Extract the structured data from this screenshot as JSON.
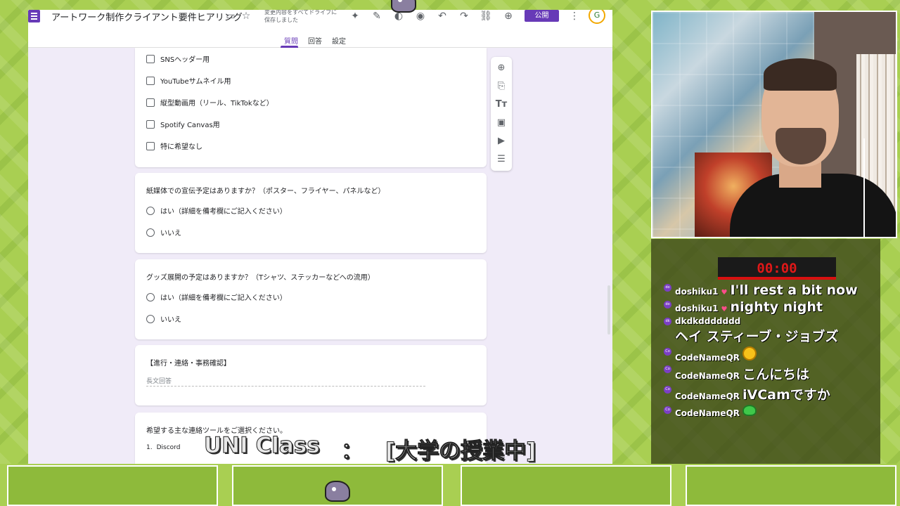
{
  "forms": {
    "title": "アートワーク制作クライアント要件ヒアリング",
    "save_status": "変更内容をすべてドライブに保存しました",
    "publish_label": "公開",
    "avatar_text": "G",
    "tabs": [
      {
        "label": "質問"
      },
      {
        "label": "回答"
      },
      {
        "label": "設定"
      }
    ],
    "checkbox_options": [
      {
        "label": "SNSヘッダー用"
      },
      {
        "label": "YouTubeサムネイル用"
      },
      {
        "label": "縦型動画用（リール、TikTokなど）"
      },
      {
        "label": "Spotify Canvas用"
      },
      {
        "label": "特に希望なし"
      }
    ],
    "q_print": {
      "title": "紙媒体での宣伝予定はありますか？（ポスター、フライヤー、パネルなど）",
      "options": [
        "はい（詳細を備考欄にご記入ください）",
        "いいえ"
      ]
    },
    "q_goods": {
      "title": "グッズ展開の予定はありますか？（Tシャツ、ステッカーなどへの流用）",
      "options": [
        "はい（詳細を備考欄にご記入ください）",
        "いいえ"
      ]
    },
    "section": {
      "title": "【進行・連絡・事務確認】",
      "placeholder": "長文回答"
    },
    "q_tools": {
      "title": "希望する主な連絡ツールをご選択ください。",
      "first_item_number": "1.",
      "first_item": "Discord"
    }
  },
  "timer": "00:00",
  "chat": [
    {
      "badge": "do",
      "user": "doshiku1",
      "heart": true,
      "text": "I'll rest a bit now"
    },
    {
      "badge": "do",
      "user": "doshiku1",
      "heart": true,
      "text": "nighty night"
    },
    {
      "badge": "dk",
      "user": "dkdkddddddd",
      "heart": false,
      "text": "ヘイ スティーブ・ジョブズ"
    },
    {
      "badge": "Co",
      "user": "CodeNameQR",
      "heart": false,
      "text": "",
      "emoji": "grinning-face"
    },
    {
      "badge": "Co",
      "user": "CodeNameQR",
      "heart": false,
      "text": "こんにちは"
    },
    {
      "badge": "Co",
      "user": "CodeNameQR",
      "heart": false,
      "text": "iVCamですか"
    },
    {
      "badge": "Co",
      "user": "CodeNameQR",
      "heart": false,
      "text": "",
      "emoji": "frog-face"
    }
  ],
  "caption": {
    "left": "UNI Class",
    "separator": "：",
    "right": "[大学の授業中]"
  },
  "colors": {
    "forms_purple": "#673ab7",
    "forms_bg": "#f0ebf8",
    "timer_red": "#e01818",
    "stream_green": "#a9cf52"
  }
}
